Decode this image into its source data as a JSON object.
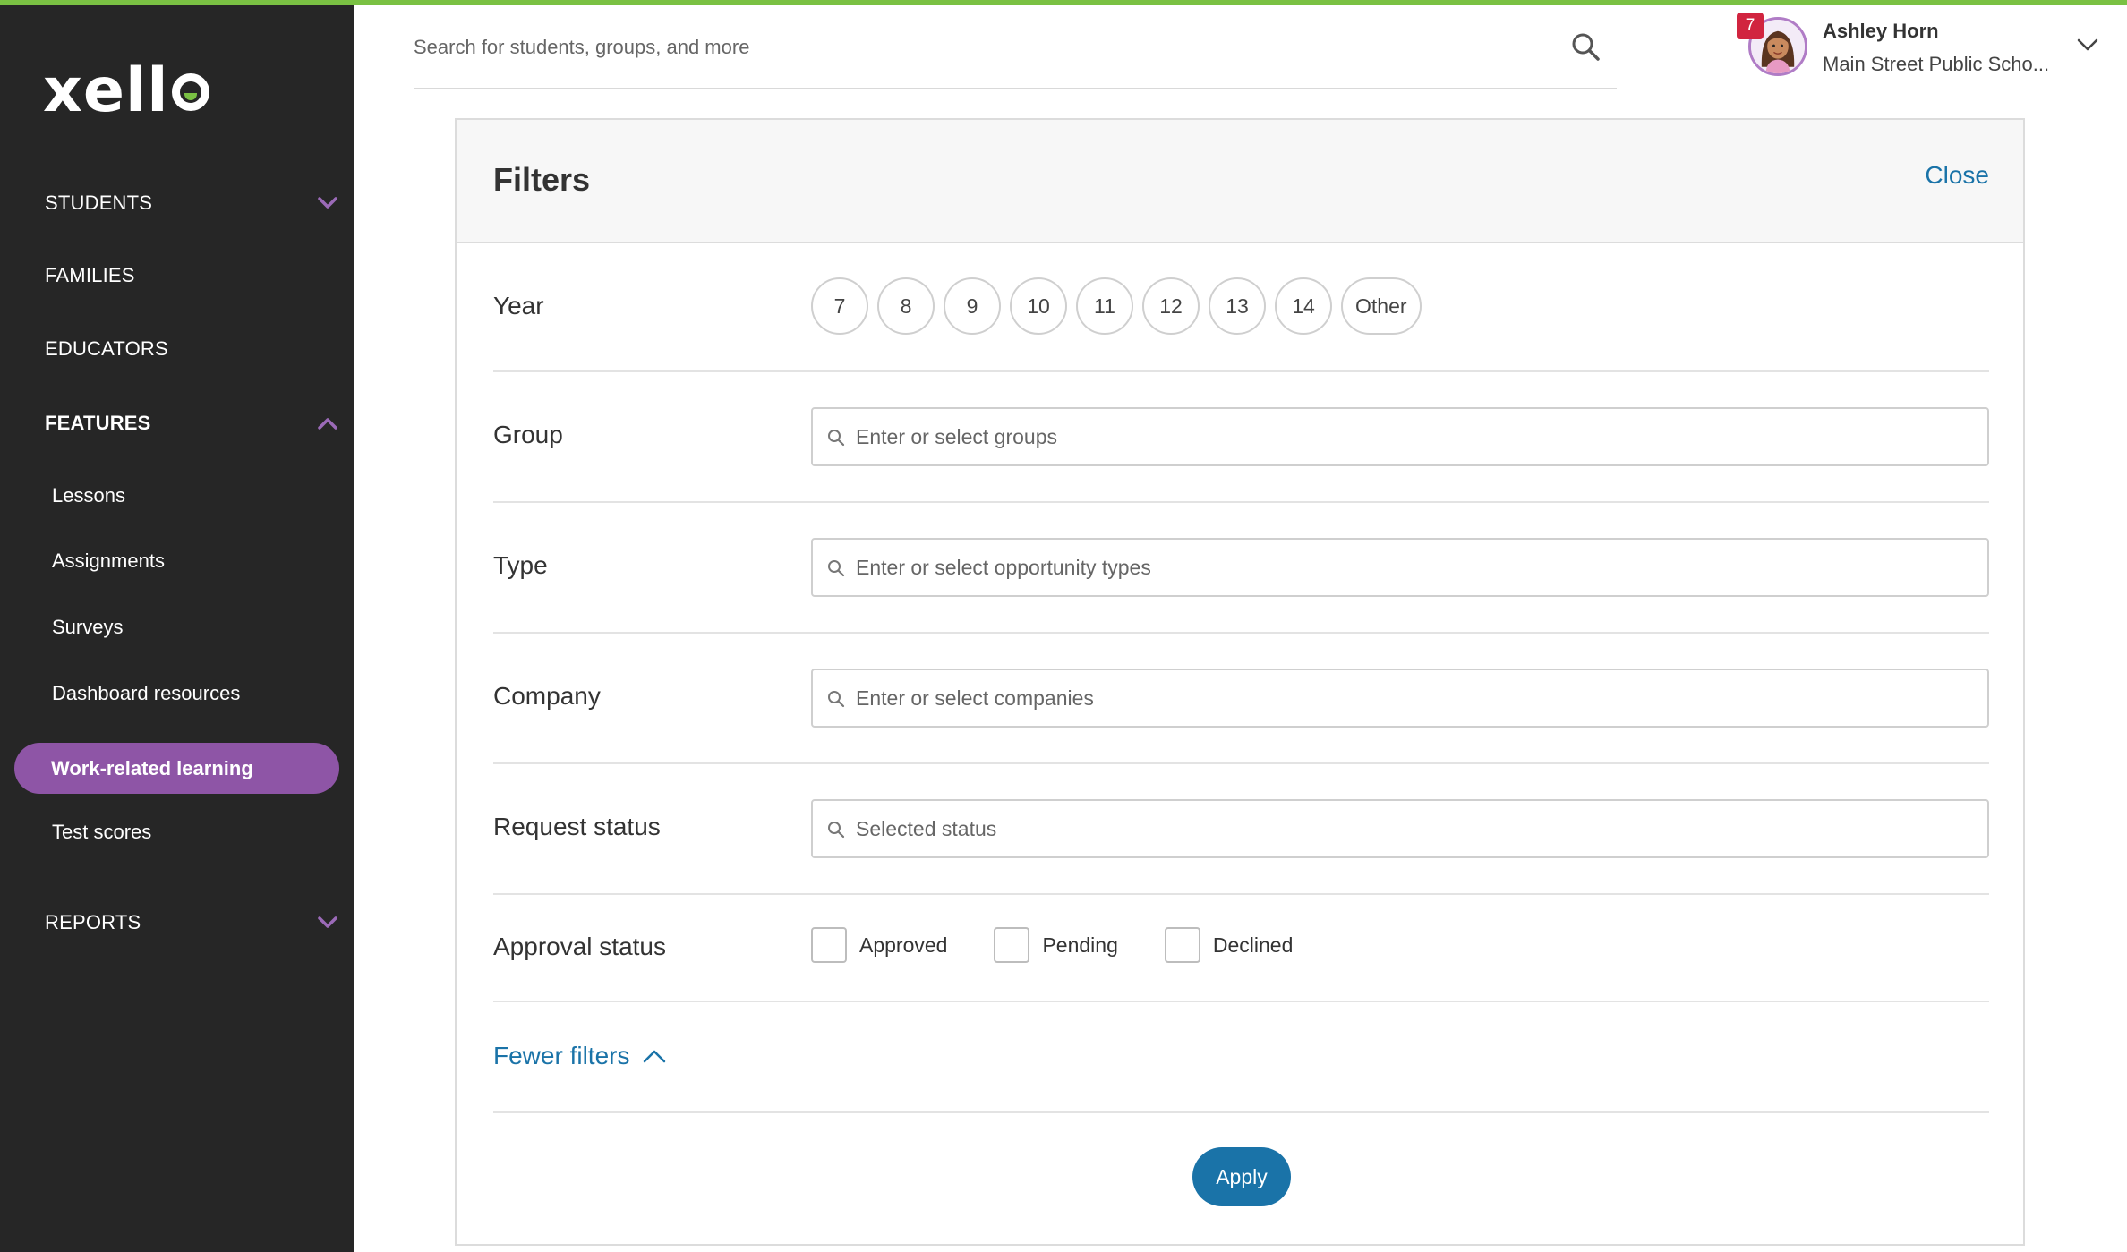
{
  "brand": {
    "logo_text": "xello",
    "accent": "#7ac143",
    "nav_active": "#8e55a6",
    "link": "#1a73a8"
  },
  "search": {
    "placeholder": "Search for students, groups, and more"
  },
  "user": {
    "notifications": "7",
    "name": "Ashley Horn",
    "school": "Main Street Public Scho..."
  },
  "sidebar": {
    "students": "STUDENTS",
    "families": "FAMILIES",
    "educators": "EDUCATORS",
    "features": "FEATURES",
    "items": [
      "Lessons",
      "Assignments",
      "Surveys",
      "Dashboard resources",
      "Work-related learning",
      "Test scores"
    ],
    "reports": "REPORTS"
  },
  "filters": {
    "title": "Filters",
    "close": "Close",
    "year_label": "Year",
    "years": [
      "7",
      "8",
      "9",
      "10",
      "11",
      "12",
      "13",
      "14",
      "Other"
    ],
    "group_label": "Group",
    "group_placeholder": "Enter or select groups",
    "type_label": "Type",
    "type_placeholder": "Enter or select opportunity types",
    "company_label": "Company",
    "company_placeholder": "Enter or select companies",
    "request_label": "Request status",
    "request_placeholder": "Selected status",
    "approval_label": "Approval status",
    "approval_options": [
      "Approved",
      "Pending",
      "Declined"
    ],
    "fewer": "Fewer filters",
    "apply": "Apply"
  }
}
